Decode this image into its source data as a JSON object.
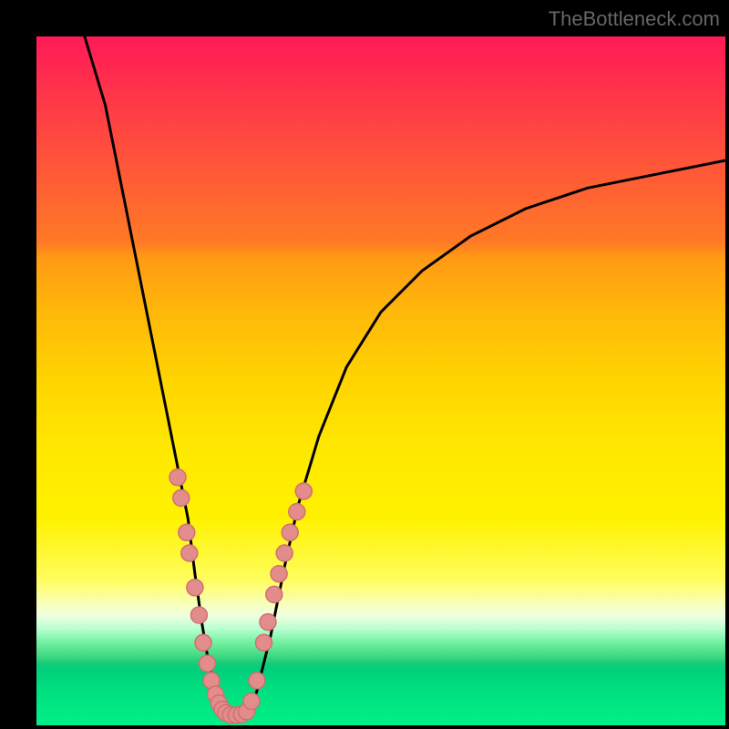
{
  "watermark": "TheBottleneck.com",
  "colors": {
    "frame": "#000000",
    "watermark": "#666666",
    "curve": "#000000",
    "dot_fill": "#e38c8c",
    "dot_stroke": "#d07070"
  },
  "chart_data": {
    "type": "line",
    "title": "",
    "xlabel": "",
    "ylabel": "",
    "xlim": [
      0,
      100
    ],
    "ylim": [
      0,
      100
    ],
    "series": [
      {
        "name": "bottleneck-curve",
        "x": [
          7,
          10,
          13,
          16,
          18,
          20,
          22,
          23,
          24,
          25,
          26,
          27,
          28,
          29,
          30,
          31,
          32,
          34,
          36,
          38,
          41,
          45,
          50,
          56,
          63,
          71,
          80,
          90,
          100
        ],
        "y": [
          100,
          90,
          75,
          60,
          50,
          40,
          30,
          22,
          15,
          9,
          5,
          3,
          2,
          1.5,
          1.5,
          2,
          5,
          13,
          23,
          32,
          42,
          52,
          60,
          66,
          71,
          75,
          78,
          80,
          82
        ]
      }
    ],
    "scatter": [
      {
        "name": "marked-points-left",
        "x": [
          20.5,
          21.0,
          21.8,
          22.2,
          23.0,
          23.6,
          24.2,
          24.8,
          25.4,
          26.0,
          26.5,
          27.0
        ],
        "y": [
          36,
          33,
          28,
          25,
          20,
          16,
          12,
          9,
          6.5,
          4.5,
          3.2,
          2.3
        ]
      },
      {
        "name": "marked-points-bottom",
        "x": [
          27.5,
          28.2,
          29.0,
          29.8,
          30.5
        ],
        "y": [
          1.8,
          1.5,
          1.5,
          1.6,
          2.0
        ]
      },
      {
        "name": "marked-points-right",
        "x": [
          31.2,
          32.0,
          33.0,
          33.6,
          34.5,
          35.2,
          36.0,
          36.8,
          37.8,
          38.8
        ],
        "y": [
          3.5,
          6.5,
          12,
          15,
          19,
          22,
          25,
          28,
          31,
          34
        ]
      }
    ]
  }
}
